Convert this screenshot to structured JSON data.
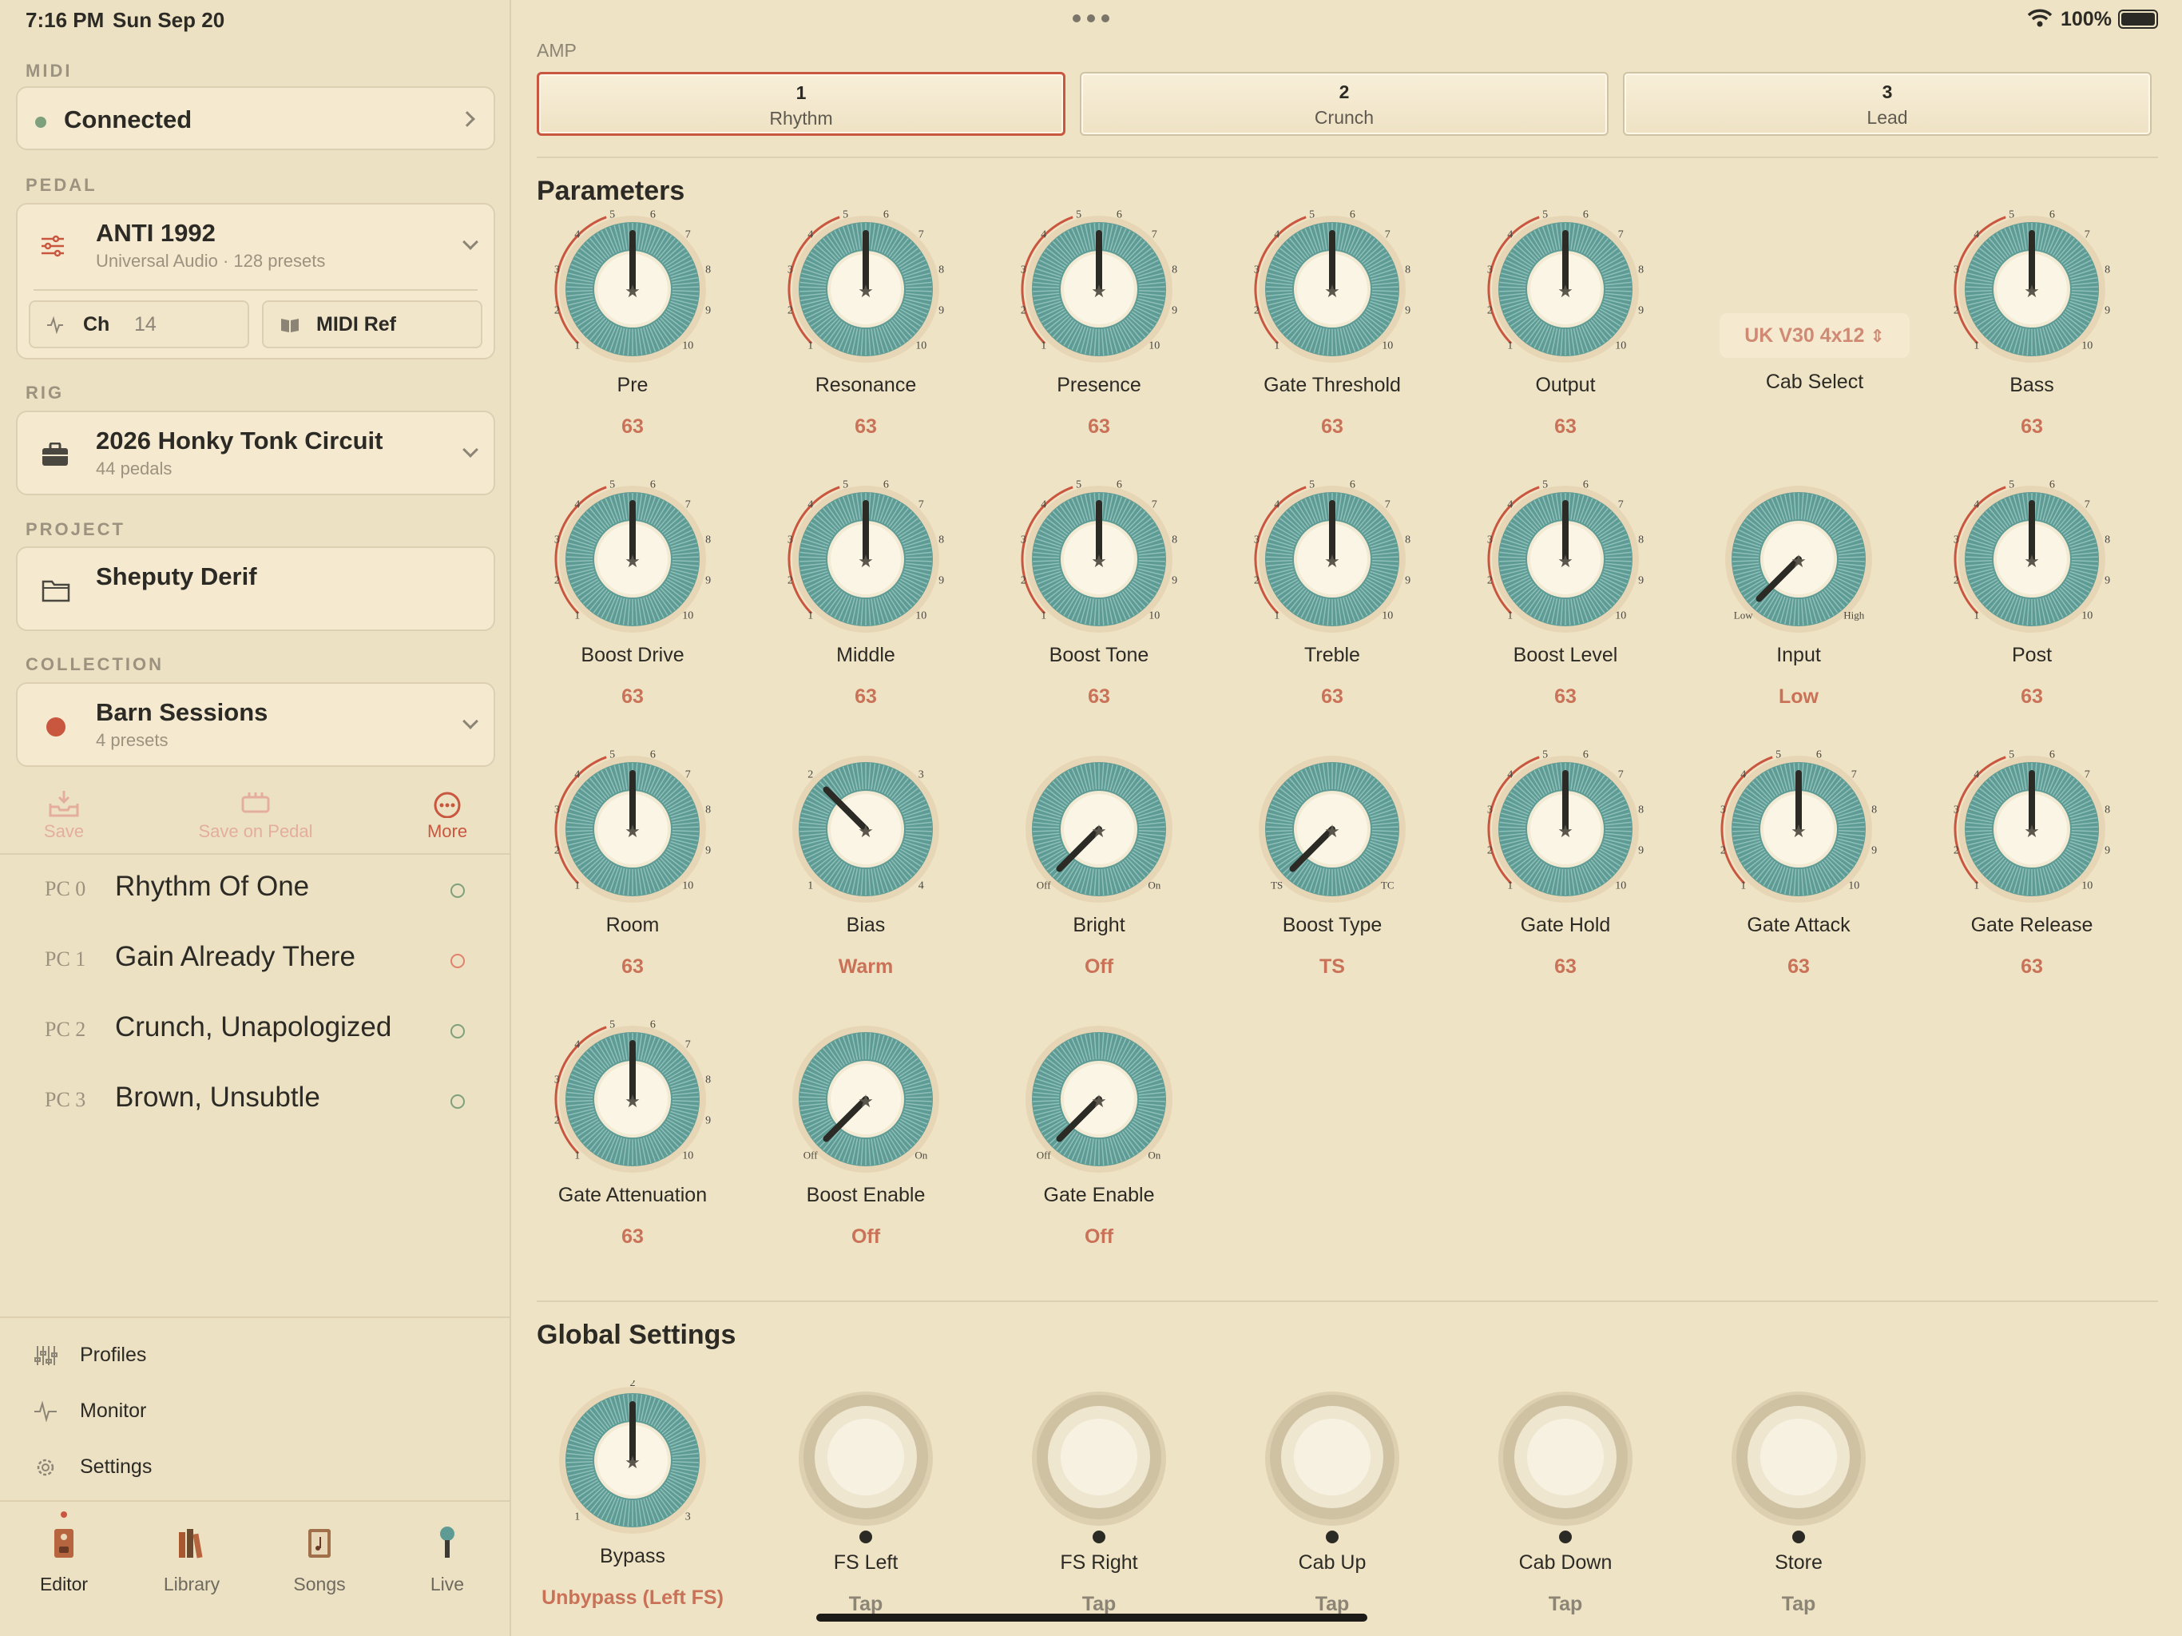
{
  "status_bar": {
    "time": "7:16 PM",
    "date": "Sun Sep 20",
    "battery": "100%"
  },
  "colors": {
    "accent": "#c9563f",
    "teal": "#5e9b95",
    "value": "#c97258",
    "connected": "#7ea07c"
  },
  "sidebar": {
    "midi": {
      "section": "MIDI",
      "status": "Connected"
    },
    "pedal": {
      "section": "PEDAL",
      "name": "ANTI 1992",
      "subtitle": "Universal Audio · 128 presets",
      "channel_label": "Ch",
      "channel_value": "14",
      "midi_ref": "MIDI Ref"
    },
    "rig": {
      "section": "RIG",
      "name": "2026 Honky Tonk Circuit",
      "subtitle": "44 pedals"
    },
    "project": {
      "section": "PROJECT",
      "name": "Sheputy Derif"
    },
    "collection": {
      "section": "COLLECTION",
      "name": "Barn Sessions",
      "subtitle": "4 presets"
    },
    "actions": {
      "save": "Save",
      "save_on_pedal": "Save on Pedal",
      "more": "More"
    },
    "presets": [
      {
        "pc": "PC 0",
        "name": "Rhythm Of One",
        "status": "green"
      },
      {
        "pc": "PC 1",
        "name": "Gain Already There",
        "status": "red"
      },
      {
        "pc": "PC 2",
        "name": "Crunch, Unapologized",
        "status": "green"
      },
      {
        "pc": "PC 3",
        "name": "Brown, Unsubtle",
        "status": "green"
      }
    ],
    "bottom_nav": {
      "profiles": "Profiles",
      "monitor": "Monitor",
      "settings": "Settings"
    },
    "tabs": {
      "editor": "Editor",
      "library": "Library",
      "songs": "Songs",
      "live": "Live"
    }
  },
  "main": {
    "amp": {
      "label": "AMP",
      "channels": [
        {
          "num": "1",
          "label": "Rhythm",
          "selected": true
        },
        {
          "num": "2",
          "label": "Crunch",
          "selected": false
        },
        {
          "num": "3",
          "label": "Lead",
          "selected": false
        }
      ]
    },
    "parameters": {
      "title": "Parameters",
      "cab_select": {
        "value": "UK V30 4x12",
        "label": "Cab Select"
      },
      "knobs": [
        {
          "label": "Pre",
          "value": "63",
          "type": "dial"
        },
        {
          "label": "Resonance",
          "value": "63",
          "type": "dial"
        },
        {
          "label": "Presence",
          "value": "63",
          "type": "dial"
        },
        {
          "label": "Gate Threshold",
          "value": "63",
          "type": "dial"
        },
        {
          "label": "Output",
          "value": "63",
          "type": "dial"
        },
        {
          "label": "Bass",
          "value": "63",
          "type": "dial"
        },
        {
          "label": "Boost Drive",
          "value": "63",
          "type": "dial"
        },
        {
          "label": "Middle",
          "value": "63",
          "type": "dial"
        },
        {
          "label": "Boost Tone",
          "value": "63",
          "type": "dial"
        },
        {
          "label": "Treble",
          "value": "63",
          "type": "dial"
        },
        {
          "label": "Boost Level",
          "value": "63",
          "type": "dial"
        },
        {
          "label": "Input",
          "value": "Low",
          "type": "switch",
          "min": "Low",
          "max": "High"
        },
        {
          "label": "Post",
          "value": "63",
          "type": "dial"
        },
        {
          "label": "Room",
          "value": "63",
          "type": "dial"
        },
        {
          "label": "Bias",
          "value": "Warm",
          "type": "bias"
        },
        {
          "label": "Bright",
          "value": "Off",
          "type": "switch",
          "min": "Off",
          "max": "On"
        },
        {
          "label": "Boost Type",
          "value": "TS",
          "type": "switch",
          "min": "TS",
          "max": "TC"
        },
        {
          "label": "Gate Hold",
          "value": "63",
          "type": "dial"
        },
        {
          "label": "Gate Attack",
          "value": "63",
          "type": "dial"
        },
        {
          "label": "Gate Release",
          "value": "63",
          "type": "dial"
        },
        {
          "label": "Gate Attenuation",
          "value": "63",
          "type": "dial"
        },
        {
          "label": "Boost Enable",
          "value": "Off",
          "type": "switch",
          "min": "Off",
          "max": "On"
        },
        {
          "label": "Gate Enable",
          "value": "Off",
          "type": "switch",
          "min": "Off",
          "max": "On"
        }
      ]
    },
    "global": {
      "title": "Global Settings",
      "bypass": {
        "label": "Bypass",
        "value": "Unbypass (Left FS)"
      },
      "switches": [
        {
          "label": "FS Left",
          "value": "Tap"
        },
        {
          "label": "FS Right",
          "value": "Tap"
        },
        {
          "label": "Cab Up",
          "value": "Tap"
        },
        {
          "label": "Cab Down",
          "value": "Tap"
        },
        {
          "label": "Store",
          "value": "Tap"
        }
      ]
    }
  }
}
